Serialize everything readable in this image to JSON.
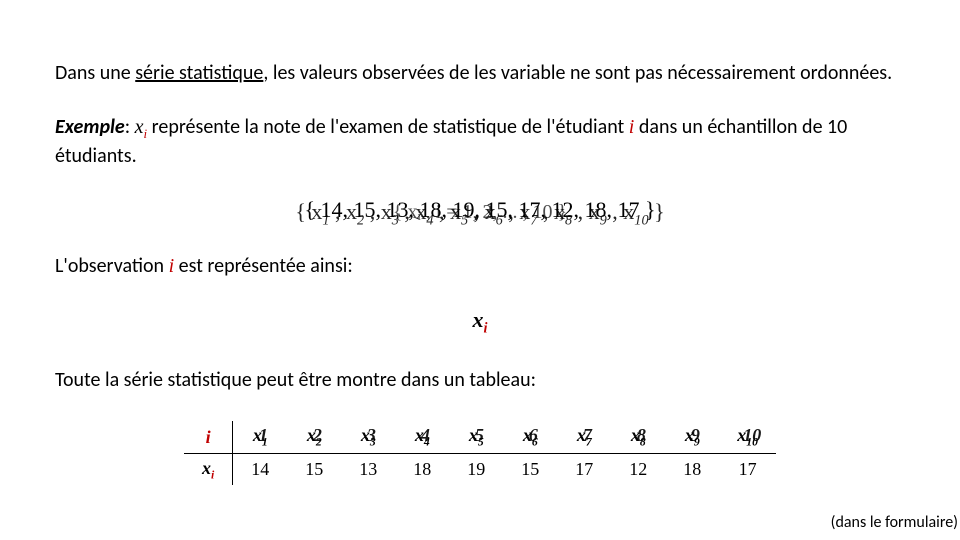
{
  "intro": {
    "prefix": "Dans une ",
    "underlined": "série statistique",
    "suffix": ", les valeurs observées de les variable ne sont pas nécessairement ordonnées."
  },
  "example": {
    "label": "Exemple",
    "before_xi": ": ",
    "x": "x",
    "i": "i",
    "text1": " représente la note de l'examen de statistique de l'étudiant ",
    "text2": " dans un échantillon de 10 étudiants."
  },
  "set_top": "{ 14, 15, 13, 18, 19, 15, 17, 12, 18, 17 }",
  "set_bottom_prefix": "{ x",
  "set_indices": [
    "1",
    "2",
    "3",
    "4",
    "5",
    "6",
    "7",
    "8",
    "9",
    "10"
  ],
  "set_joiner": " , x",
  "set_bottom_suffix": " }",
  "set_i_expr": "{ xᵢ , i = 1, 2, ... , 10 }",
  "obs": {
    "prefix": "L'observation ",
    "i": "i",
    "suffix": " est représentée ainsi:"
  },
  "xi_display": {
    "x": "x",
    "i": "i"
  },
  "table_intro": "Toute la série statistique peut être montre dans un tableau:",
  "table": {
    "row1_label": "i",
    "row2_label_x": "x",
    "row2_label_i": "i",
    "cols": [
      "1",
      "2",
      "3",
      "4",
      "5",
      "6",
      "7",
      "8",
      "9",
      "10"
    ],
    "values": [
      "14",
      "15",
      "13",
      "18",
      "19",
      "15",
      "17",
      "12",
      "18",
      "17"
    ]
  },
  "footer": "(dans le formulaire)"
}
